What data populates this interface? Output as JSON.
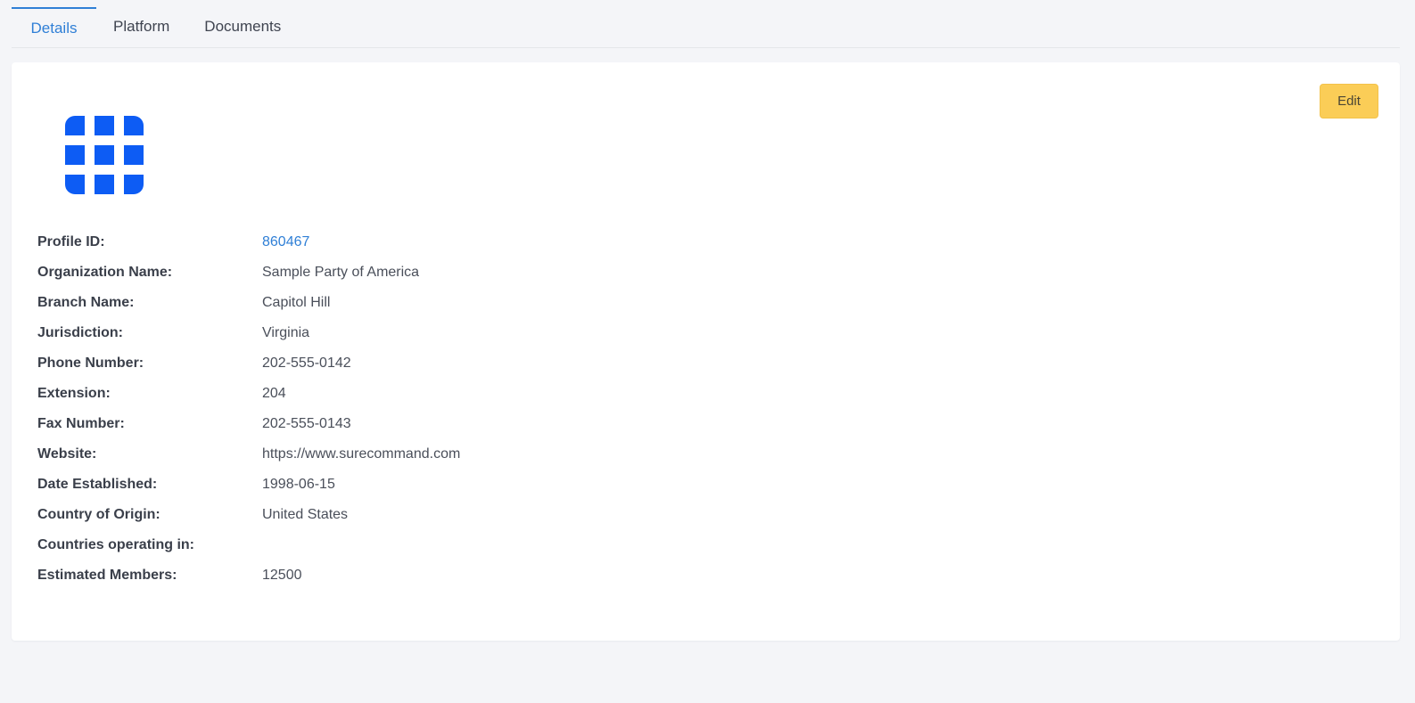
{
  "tabs": [
    {
      "label": "Details",
      "active": true
    },
    {
      "label": "Platform",
      "active": false
    },
    {
      "label": "Documents",
      "active": false
    }
  ],
  "edit_button": {
    "label": "Edit"
  },
  "logo": {
    "icon": "grid-logo-icon",
    "color": "#0d5cf4"
  },
  "fields": [
    {
      "label": "Profile ID:",
      "value": "860467",
      "link": true
    },
    {
      "label": "Organization Name:",
      "value": "Sample Party of America"
    },
    {
      "label": "Branch Name:",
      "value": "Capitol Hill"
    },
    {
      "label": "Jurisdiction:",
      "value": "Virginia"
    },
    {
      "label": "Phone Number:",
      "value": "202-555-0142"
    },
    {
      "label": "Extension:",
      "value": "204"
    },
    {
      "label": "Fax Number:",
      "value": "202-555-0143"
    },
    {
      "label": "Website:",
      "value": "https://www.surecommand.com"
    },
    {
      "label": "Date Established:",
      "value": "1998-06-15"
    },
    {
      "label": "Country of Origin:",
      "value": "United States"
    },
    {
      "label": "Countries operating in:",
      "value": ""
    },
    {
      "label": "Estimated Members:",
      "value": "12500"
    }
  ],
  "colors": {
    "accent": "#2f7fd6",
    "edit_button": "#fbcd57",
    "background": "#f4f5f8"
  }
}
